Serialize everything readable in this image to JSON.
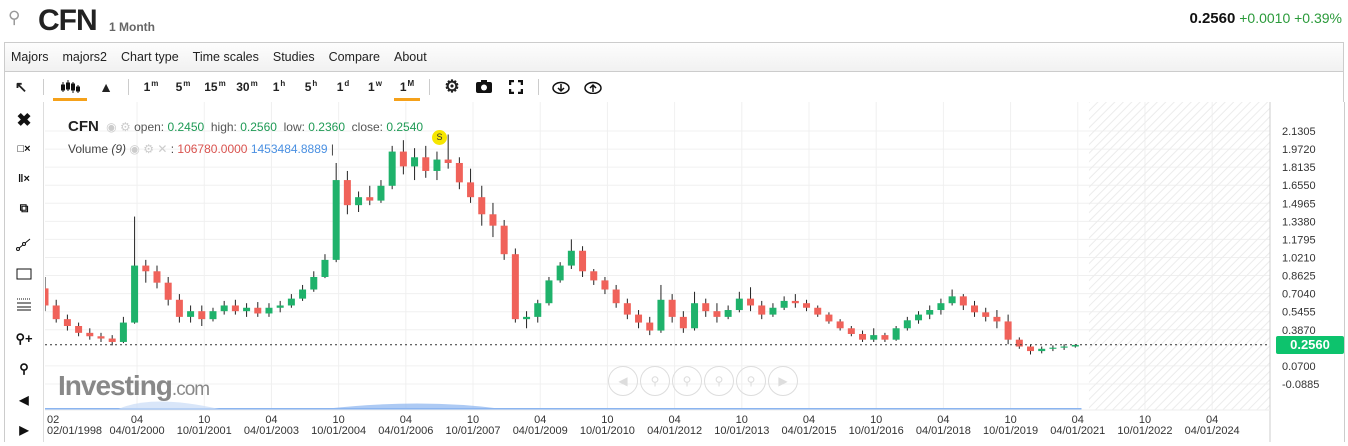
{
  "header": {
    "symbol": "CFN",
    "period": "1 Month",
    "last": "0.2560",
    "change": "+0.0010",
    "change_pct": "+0.39%"
  },
  "menu": [
    "Majors",
    "majors2",
    "Chart type",
    "Time scales",
    "Studies",
    "Compare",
    "About"
  ],
  "toolbar": {
    "intervals": [
      {
        "n": "1",
        "u": "m"
      },
      {
        "n": "5",
        "u": "m"
      },
      {
        "n": "15",
        "u": "m"
      },
      {
        "n": "30",
        "u": "m"
      },
      {
        "n": "1",
        "u": "h"
      },
      {
        "n": "5",
        "u": "h"
      },
      {
        "n": "1",
        "u": "d"
      },
      {
        "n": "1",
        "u": "w"
      },
      {
        "n": "1",
        "u": "M"
      }
    ],
    "active_interval": "1M",
    "active_chart_type": "candlestick"
  },
  "legend": {
    "symbol": "CFN",
    "open_label": "open:",
    "open": "0.2450",
    "high_label": "high:",
    "high": "0.2560",
    "low_label": "low:",
    "low": "0.2360",
    "close_label": "close:",
    "close": "0.2540",
    "volume_label": "Volume",
    "volume_param": "(9)",
    "volume_value": "106780.0000",
    "volume_ma": "1453484.8889"
  },
  "split_marker": "S",
  "logo": {
    "main": "Investing",
    "suffix": ".com"
  },
  "colors": {
    "up": "#1fb26b",
    "down": "#f0625a",
    "accent": "#f5a11a",
    "last_price": "#0dc36d"
  },
  "chart_data": {
    "type": "candlestick",
    "ylim": [
      -0.0885,
      2.1305
    ],
    "y_ticks": [
      "2.1305",
      "1.9720",
      "1.8135",
      "1.6550",
      "1.4965",
      "1.3380",
      "1.1795",
      "1.0210",
      "0.8625",
      "0.7040",
      "0.5455",
      "0.3870",
      "0.0700",
      "-0.0885"
    ],
    "last_price": "0.2560",
    "x_ticks": [
      {
        "top": "02",
        "bottom": "02/01/1998",
        "date": "1998-02"
      },
      {
        "top": "04",
        "bottom": "04/01/2000",
        "date": "2000-04"
      },
      {
        "top": "10",
        "bottom": "10/01/2001",
        "date": "2001-10"
      },
      {
        "top": "04",
        "bottom": "04/01/2003",
        "date": "2003-04"
      },
      {
        "top": "10",
        "bottom": "10/01/2004",
        "date": "2004-10"
      },
      {
        "top": "04",
        "bottom": "04/01/2006",
        "date": "2006-04"
      },
      {
        "top": "10",
        "bottom": "10/01/2007",
        "date": "2007-10"
      },
      {
        "top": "04",
        "bottom": "04/01/2009",
        "date": "2009-04"
      },
      {
        "top": "10",
        "bottom": "10/01/2010",
        "date": "2010-10"
      },
      {
        "top": "04",
        "bottom": "04/01/2012",
        "date": "2012-04"
      },
      {
        "top": "10",
        "bottom": "10/01/2013",
        "date": "2013-10"
      },
      {
        "top": "04",
        "bottom": "04/01/2015",
        "date": "2015-04"
      },
      {
        "top": "10",
        "bottom": "10/01/2016",
        "date": "2016-10"
      },
      {
        "top": "04",
        "bottom": "04/01/2018",
        "date": "2018-04"
      },
      {
        "top": "10",
        "bottom": "10/01/2019",
        "date": "2019-10"
      },
      {
        "top": "04",
        "bottom": "04/01/2021",
        "date": "2021-04"
      },
      {
        "top": "10",
        "bottom": "10/01/2022",
        "date": "2022-10"
      },
      {
        "top": "04",
        "bottom": "04/01/2024",
        "date": "2024-04"
      }
    ],
    "candles": [
      [
        "1998-02",
        0.75,
        0.85,
        0.55,
        0.6
      ],
      [
        "1998-05",
        0.6,
        0.65,
        0.45,
        0.48
      ],
      [
        "1998-08",
        0.48,
        0.52,
        0.38,
        0.42
      ],
      [
        "1998-11",
        0.42,
        0.45,
        0.33,
        0.36
      ],
      [
        "1999-02",
        0.36,
        0.4,
        0.3,
        0.33
      ],
      [
        "1999-05",
        0.33,
        0.36,
        0.28,
        0.31
      ],
      [
        "1999-08",
        0.31,
        0.34,
        0.25,
        0.28
      ],
      [
        "1999-11",
        0.28,
        0.5,
        0.27,
        0.45
      ],
      [
        "2000-02",
        0.45,
        1.38,
        0.44,
        0.95
      ],
      [
        "2000-05",
        0.95,
        1.0,
        0.8,
        0.9
      ],
      [
        "2000-08",
        0.9,
        0.95,
        0.75,
        0.8
      ],
      [
        "2000-11",
        0.8,
        0.85,
        0.6,
        0.65
      ],
      [
        "2001-02",
        0.65,
        0.7,
        0.45,
        0.5
      ],
      [
        "2001-05",
        0.5,
        0.6,
        0.45,
        0.55
      ],
      [
        "2001-08",
        0.55,
        0.6,
        0.42,
        0.48
      ],
      [
        "2001-11",
        0.48,
        0.58,
        0.46,
        0.55
      ],
      [
        "2002-02",
        0.55,
        0.64,
        0.52,
        0.6
      ],
      [
        "2002-05",
        0.6,
        0.65,
        0.52,
        0.55
      ],
      [
        "2002-08",
        0.55,
        0.62,
        0.5,
        0.58
      ],
      [
        "2002-11",
        0.58,
        0.63,
        0.5,
        0.53
      ],
      [
        "2003-02",
        0.53,
        0.62,
        0.5,
        0.58
      ],
      [
        "2003-05",
        0.58,
        0.64,
        0.54,
        0.6
      ],
      [
        "2003-08",
        0.6,
        0.7,
        0.58,
        0.66
      ],
      [
        "2003-11",
        0.66,
        0.78,
        0.64,
        0.74
      ],
      [
        "2004-02",
        0.74,
        0.9,
        0.72,
        0.85
      ],
      [
        "2004-05",
        0.85,
        1.05,
        0.84,
        1.0
      ],
      [
        "2004-08",
        1.0,
        1.85,
        0.98,
        1.7
      ],
      [
        "2004-11",
        1.7,
        1.78,
        1.4,
        1.48
      ],
      [
        "2005-02",
        1.48,
        1.6,
        1.42,
        1.55
      ],
      [
        "2005-05",
        1.55,
        1.65,
        1.48,
        1.52
      ],
      [
        "2005-08",
        1.52,
        1.7,
        1.5,
        1.65
      ],
      [
        "2005-11",
        1.65,
        2.0,
        1.62,
        1.95
      ],
      [
        "2006-02",
        1.95,
        2.05,
        1.75,
        1.82
      ],
      [
        "2006-05",
        1.82,
        1.98,
        1.7,
        1.9
      ],
      [
        "2006-08",
        1.9,
        2.0,
        1.72,
        1.78
      ],
      [
        "2006-11",
        1.78,
        1.95,
        1.7,
        1.88
      ],
      [
        "2007-02",
        1.88,
        2.1,
        1.8,
        1.85
      ],
      [
        "2007-05",
        1.85,
        1.9,
        1.62,
        1.68
      ],
      [
        "2007-08",
        1.68,
        1.8,
        1.5,
        1.55
      ],
      [
        "2007-11",
        1.55,
        1.65,
        1.3,
        1.4
      ],
      [
        "2008-02",
        1.4,
        1.5,
        1.2,
        1.3
      ],
      [
        "2008-05",
        1.3,
        1.35,
        1.0,
        1.05
      ],
      [
        "2008-08",
        1.05,
        1.1,
        0.45,
        0.48
      ],
      [
        "2008-11",
        0.48,
        0.55,
        0.4,
        0.5
      ],
      [
        "2009-02",
        0.5,
        0.65,
        0.45,
        0.62
      ],
      [
        "2009-05",
        0.62,
        0.85,
        0.6,
        0.82
      ],
      [
        "2009-08",
        0.82,
        0.98,
        0.8,
        0.95
      ],
      [
        "2009-11",
        0.95,
        1.18,
        0.92,
        1.08
      ],
      [
        "2010-02",
        1.08,
        1.12,
        0.85,
        0.9
      ],
      [
        "2010-05",
        0.9,
        0.92,
        0.78,
        0.82
      ],
      [
        "2010-08",
        0.82,
        0.85,
        0.7,
        0.74
      ],
      [
        "2010-11",
        0.74,
        0.78,
        0.58,
        0.62
      ],
      [
        "2011-02",
        0.62,
        0.66,
        0.48,
        0.52
      ],
      [
        "2011-05",
        0.52,
        0.56,
        0.4,
        0.45
      ],
      [
        "2011-08",
        0.45,
        0.5,
        0.34,
        0.38
      ],
      [
        "2011-11",
        0.38,
        0.78,
        0.36,
        0.65
      ],
      [
        "2012-02",
        0.65,
        0.7,
        0.45,
        0.5
      ],
      [
        "2012-05",
        0.5,
        0.55,
        0.36,
        0.4
      ],
      [
        "2012-08",
        0.4,
        0.72,
        0.38,
        0.62
      ],
      [
        "2012-11",
        0.62,
        0.66,
        0.5,
        0.55
      ],
      [
        "2013-02",
        0.55,
        0.62,
        0.45,
        0.5
      ],
      [
        "2013-05",
        0.5,
        0.6,
        0.48,
        0.56
      ],
      [
        "2013-08",
        0.56,
        0.72,
        0.54,
        0.66
      ],
      [
        "2013-11",
        0.66,
        0.76,
        0.55,
        0.6
      ],
      [
        "2014-02",
        0.6,
        0.64,
        0.48,
        0.52
      ],
      [
        "2014-05",
        0.52,
        0.62,
        0.5,
        0.58
      ],
      [
        "2014-08",
        0.58,
        0.68,
        0.56,
        0.64
      ],
      [
        "2014-11",
        0.64,
        0.7,
        0.58,
        0.62
      ],
      [
        "2015-02",
        0.62,
        0.65,
        0.55,
        0.58
      ],
      [
        "2015-05",
        0.58,
        0.6,
        0.5,
        0.52
      ],
      [
        "2015-08",
        0.52,
        0.54,
        0.44,
        0.46
      ],
      [
        "2015-11",
        0.46,
        0.48,
        0.38,
        0.4
      ],
      [
        "2016-02",
        0.4,
        0.42,
        0.33,
        0.35
      ],
      [
        "2016-05",
        0.35,
        0.38,
        0.28,
        0.3
      ],
      [
        "2016-08",
        0.3,
        0.4,
        0.28,
        0.34
      ],
      [
        "2016-11",
        0.34,
        0.36,
        0.28,
        0.3
      ],
      [
        "2017-02",
        0.3,
        0.42,
        0.29,
        0.4
      ],
      [
        "2017-05",
        0.4,
        0.5,
        0.38,
        0.47
      ],
      [
        "2017-08",
        0.47,
        0.55,
        0.44,
        0.52
      ],
      [
        "2017-11",
        0.52,
        0.6,
        0.48,
        0.56
      ],
      [
        "2018-02",
        0.56,
        0.66,
        0.52,
        0.62
      ],
      [
        "2018-05",
        0.62,
        0.74,
        0.6,
        0.68
      ],
      [
        "2018-08",
        0.68,
        0.7,
        0.56,
        0.6
      ],
      [
        "2018-11",
        0.6,
        0.64,
        0.5,
        0.54
      ],
      [
        "2019-02",
        0.54,
        0.58,
        0.46,
        0.5
      ],
      [
        "2019-05",
        0.5,
        0.56,
        0.4,
        0.46
      ],
      [
        "2019-08",
        0.46,
        0.52,
        0.26,
        0.3
      ],
      [
        "2019-11",
        0.3,
        0.32,
        0.22,
        0.24
      ],
      [
        "2020-02",
        0.24,
        0.26,
        0.17,
        0.2
      ],
      [
        "2020-05",
        0.2,
        0.24,
        0.18,
        0.22
      ],
      [
        "2020-08",
        0.22,
        0.25,
        0.2,
        0.23
      ],
      [
        "2020-11",
        0.23,
        0.26,
        0.21,
        0.24
      ],
      [
        "2021-02",
        0.24,
        0.26,
        0.23,
        0.254
      ]
    ]
  }
}
